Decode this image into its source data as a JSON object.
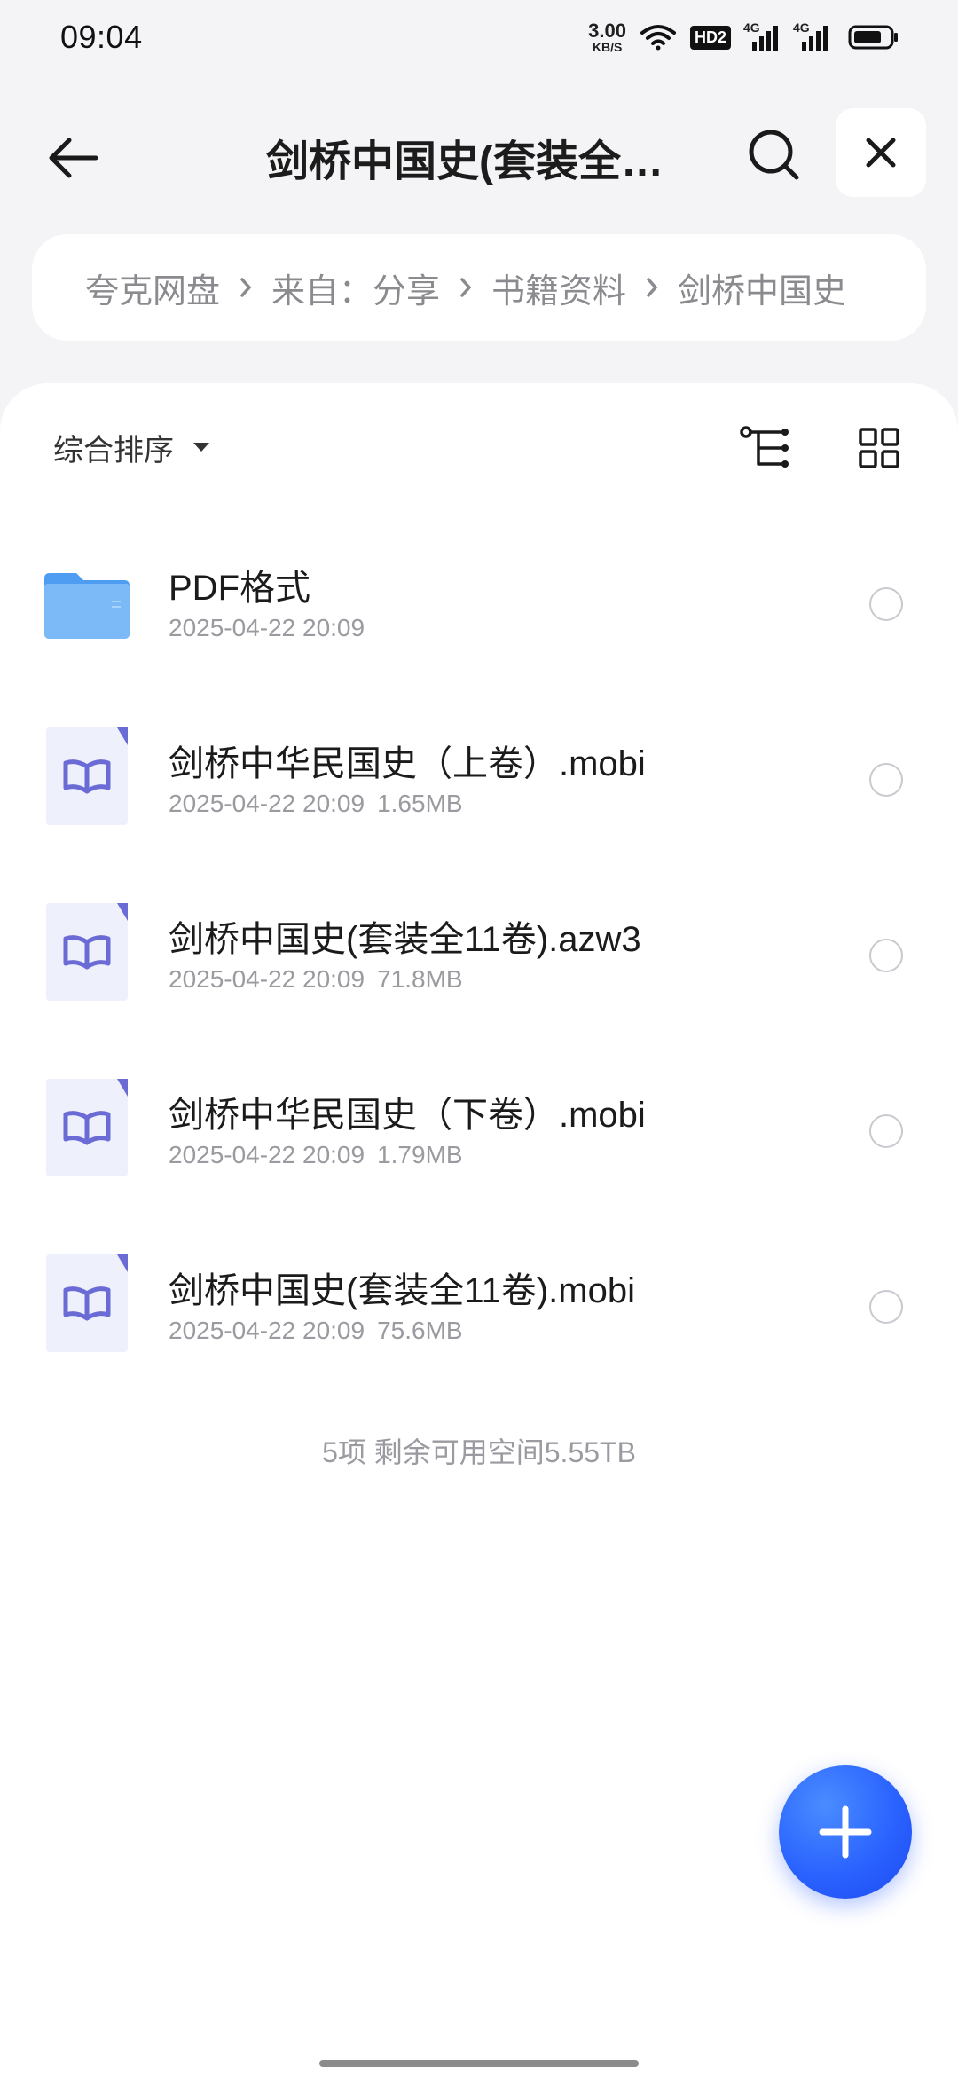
{
  "status_bar": {
    "time": "09:04",
    "net_speed_value": "3.00",
    "net_speed_unit": "KB/S",
    "hd_badge": "HD2",
    "signal1_label": "4G",
    "signal2_label": "4G",
    "icons": [
      "wifi-icon",
      "hd-badge",
      "signal-icon",
      "signal-icon",
      "battery-icon"
    ]
  },
  "header": {
    "title": "剑桥中国史(套装全…",
    "icons": {
      "back": "arrow-left-icon",
      "search": "search-icon",
      "close": "close-icon"
    }
  },
  "breadcrumb": {
    "items": [
      "夸克网盘",
      "来自：分享",
      "书籍资料",
      "剑桥中国史"
    ]
  },
  "toolbar": {
    "sort_label": "综合排序",
    "icons": {
      "sort_dropdown": "caret-down-icon",
      "tree": "tree-view-icon",
      "grid": "grid-view-icon"
    }
  },
  "files": [
    {
      "name": "PDF格式",
      "date": "2025-04-22 20:09",
      "size": "",
      "type": "folder"
    },
    {
      "name": "剑桥中华民国史（上卷）.mobi",
      "date": "2025-04-22 20:09",
      "size": "1.65MB",
      "type": "ebook"
    },
    {
      "name": "剑桥中国史(套装全11卷).azw3",
      "date": "2025-04-22 20:09",
      "size": "71.8MB",
      "type": "ebook"
    },
    {
      "name": "剑桥中华民国史（下卷）.mobi",
      "date": "2025-04-22 20:09",
      "size": "1.79MB",
      "type": "ebook"
    },
    {
      "name": "剑桥中国史(套装全11卷).mobi",
      "date": "2025-04-22 20:09",
      "size": "75.6MB",
      "type": "ebook"
    }
  ],
  "summary": "5项 剩余可用空间5.55TB",
  "fab": {
    "icon": "plus-icon"
  },
  "colors": {
    "accent": "#2a63ff",
    "folder": "#5aa9f5",
    "ebook_icon": "#6b6bd6",
    "bg": "#f4f4f6"
  }
}
